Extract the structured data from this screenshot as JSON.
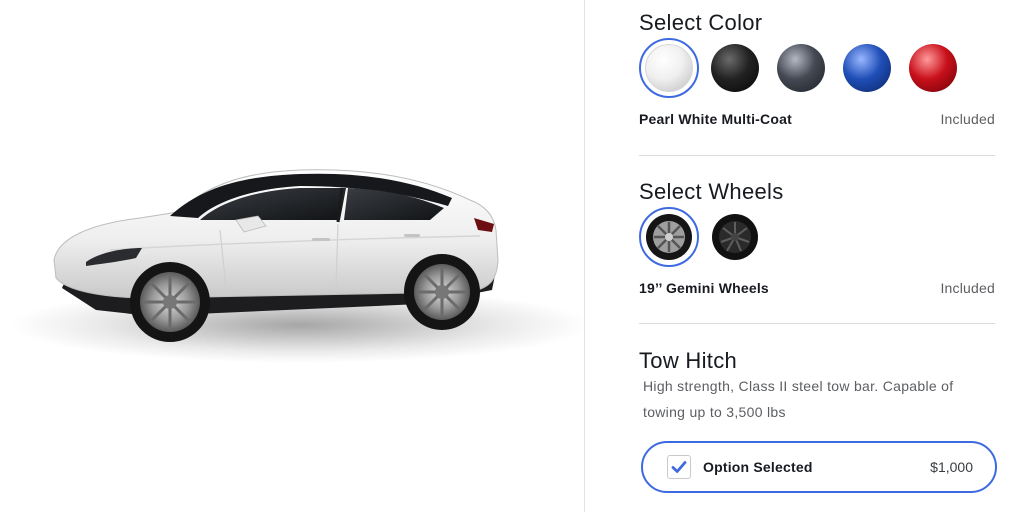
{
  "color_section": {
    "title": "Select Color",
    "selected_name": "Pearl White Multi-Coat",
    "selected_price": "Included",
    "swatches": [
      {
        "icon": "pearl-white-swatch",
        "color": "#f2f2f2",
        "selected": true
      },
      {
        "icon": "solid-black-swatch",
        "color": "#1a1a1a",
        "selected": false
      },
      {
        "icon": "midnight-silver-swatch",
        "color": "#3b3f47",
        "selected": false
      },
      {
        "icon": "deep-blue-swatch",
        "color": "#1f4fb8",
        "selected": false
      },
      {
        "icon": "red-multi-coat-swatch",
        "color": "#c8101b",
        "selected": false
      }
    ]
  },
  "wheels_section": {
    "title": "Select Wheels",
    "selected_name": "19’’ Gemini Wheels",
    "selected_price": "Included",
    "swatches": [
      {
        "icon": "gemini-wheel-swatch",
        "selected": true
      },
      {
        "icon": "induction-wheel-swatch",
        "selected": false
      }
    ]
  },
  "tow_hitch": {
    "title": "Tow Hitch",
    "description": "High strength, Class II steel tow bar. Capable of towing up to 3,500 lbs",
    "option_label": "Option Selected",
    "option_price": "$1,000",
    "checked": true
  },
  "vehicle": {
    "paint_color": "#f4f4f4",
    "image": "model-y-side-view"
  },
  "accent_color": "#3e6ae1"
}
